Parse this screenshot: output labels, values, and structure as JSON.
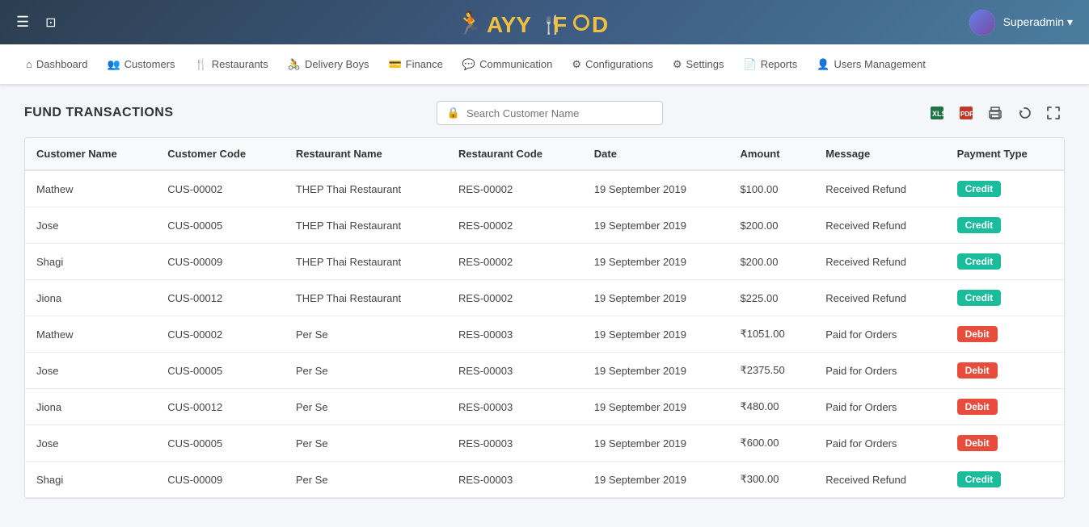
{
  "header": {
    "logo_text": "AYY F OD",
    "user_name": "Superadmin",
    "dropdown_label": "Superadmin ▾"
  },
  "nav": {
    "items": [
      {
        "label": "Dashboard",
        "icon": "⌂"
      },
      {
        "label": "Customers",
        "icon": "👥"
      },
      {
        "label": "Restaurants",
        "icon": "🍴"
      },
      {
        "label": "Delivery Boys",
        "icon": "🚴"
      },
      {
        "label": "Finance",
        "icon": "💳"
      },
      {
        "label": "Communication",
        "icon": "💬"
      },
      {
        "label": "Configurations",
        "icon": "⚙"
      },
      {
        "label": "Settings",
        "icon": "⚙"
      },
      {
        "label": "Reports",
        "icon": "📄"
      },
      {
        "label": "Users Management",
        "icon": "👤"
      }
    ]
  },
  "page": {
    "title": "FUND TRANSACTIONS",
    "search_placeholder": "Search Customer Name"
  },
  "table": {
    "columns": [
      "Customer Name",
      "Customer Code",
      "Restaurant Name",
      "Restaurant Code",
      "Date",
      "Amount",
      "Message",
      "Payment Type"
    ],
    "rows": [
      {
        "customer_name": "Mathew",
        "customer_code": "CUS-00002",
        "restaurant_name": "THEP Thai Restaurant",
        "restaurant_code": "RES-00002",
        "date": "19 September 2019",
        "amount": "$100.00",
        "message": "Received Refund",
        "payment_type": "Credit",
        "payment_class": "credit"
      },
      {
        "customer_name": "Jose",
        "customer_code": "CUS-00005",
        "restaurant_name": "THEP Thai Restaurant",
        "restaurant_code": "RES-00002",
        "date": "19 September 2019",
        "amount": "$200.00",
        "message": "Received Refund",
        "payment_type": "Credit",
        "payment_class": "credit"
      },
      {
        "customer_name": "Shagi",
        "customer_code": "CUS-00009",
        "restaurant_name": "THEP Thai Restaurant",
        "restaurant_code": "RES-00002",
        "date": "19 September 2019",
        "amount": "$200.00",
        "message": "Received Refund",
        "payment_type": "Credit",
        "payment_class": "credit"
      },
      {
        "customer_name": "Jiona",
        "customer_code": "CUS-00012",
        "restaurant_name": "THEP Thai Restaurant",
        "restaurant_code": "RES-00002",
        "date": "19 September 2019",
        "amount": "$225.00",
        "message": "Received Refund",
        "payment_type": "Credit",
        "payment_class": "credit"
      },
      {
        "customer_name": "Mathew",
        "customer_code": "CUS-00002",
        "restaurant_name": "Per Se",
        "restaurant_code": "RES-00003",
        "date": "19 September 2019",
        "amount": "₹1051.00",
        "message": "Paid for Orders",
        "payment_type": "Debit",
        "payment_class": "debit"
      },
      {
        "customer_name": "Jose",
        "customer_code": "CUS-00005",
        "restaurant_name": "Per Se",
        "restaurant_code": "RES-00003",
        "date": "19 September 2019",
        "amount": "₹2375.50",
        "message": "Paid for Orders",
        "payment_type": "Debit",
        "payment_class": "debit"
      },
      {
        "customer_name": "Jiona",
        "customer_code": "CUS-00012",
        "restaurant_name": "Per Se",
        "restaurant_code": "RES-00003",
        "date": "19 September 2019",
        "amount": "₹480.00",
        "message": "Paid for Orders",
        "payment_type": "Debit",
        "payment_class": "debit"
      },
      {
        "customer_name": "Jose",
        "customer_code": "CUS-00005",
        "restaurant_name": "Per Se",
        "restaurant_code": "RES-00003",
        "date": "19 September 2019",
        "amount": "₹600.00",
        "message": "Paid for Orders",
        "payment_type": "Debit",
        "payment_class": "debit"
      },
      {
        "customer_name": "Shagi",
        "customer_code": "CUS-00009",
        "restaurant_name": "Per Se",
        "restaurant_code": "RES-00003",
        "date": "19 September 2019",
        "amount": "₹300.00",
        "message": "Received Refund",
        "payment_type": "Credit",
        "payment_class": "credit"
      }
    ]
  },
  "icons": {
    "excel": "📊",
    "pdf": "📕",
    "print": "🖨",
    "refresh": "🔄",
    "fullscreen": "⛶",
    "search": "🔍",
    "lock": "🔒"
  }
}
